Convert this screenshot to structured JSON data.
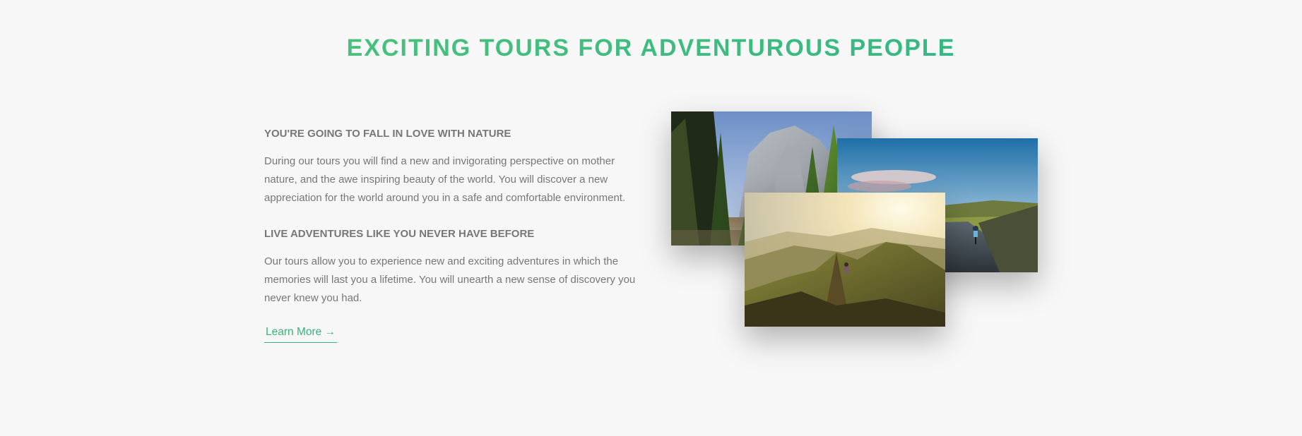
{
  "section": {
    "title": "EXCITING TOURS FOR ADVENTUROUS PEOPLE",
    "block1": {
      "heading": "YOU'RE GOING TO FALL IN LOVE WITH NATURE",
      "text": "During our tours you will find a new and invigorating perspective on mother nature, and the awe inspiring beauty of the world. You will discover a new appreciation for the world around you in a safe and comfortable environment."
    },
    "block2": {
      "heading": "LIVE ADVENTURES LIKE YOU NEVER HAVE BEFORE",
      "text": "Our tours allow you to experience new and exciting adventures in which the memories will last you a lifetime. You will unearth a new sense of discovery you never knew you had."
    },
    "link_label": "Learn More →"
  },
  "colors": {
    "accent": "#55c57a",
    "accent_dark": "#28b485",
    "text": "#777777",
    "background": "#f7f7f7"
  },
  "images": [
    {
      "name": "forest-cliffs-photo"
    },
    {
      "name": "cyclist-road-photo"
    },
    {
      "name": "mountain-ridge-hiker-photo"
    }
  ]
}
